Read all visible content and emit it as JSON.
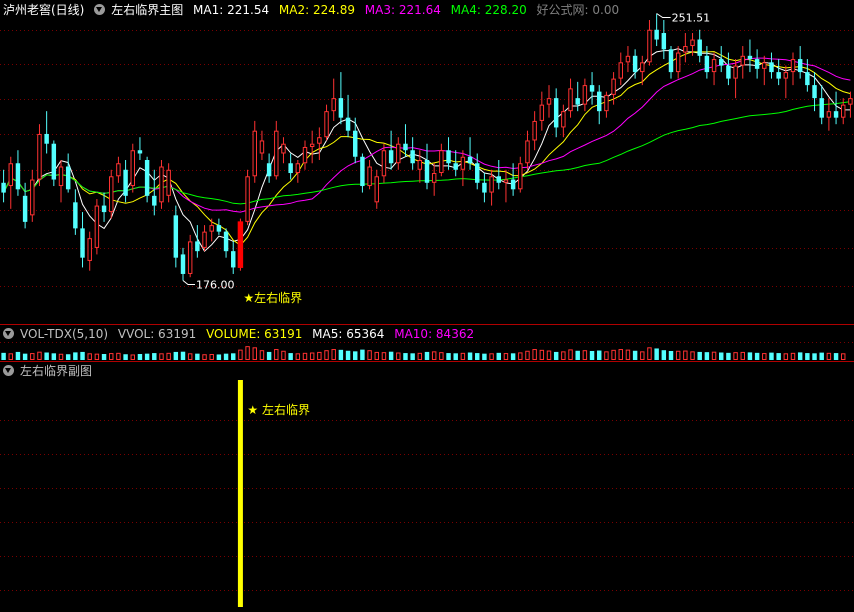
{
  "main_header": {
    "stock": "泸州老窖(日线)",
    "indicator": "左右临界主图",
    "ma1": "MA1: 221.54",
    "ma2": "MA2: 224.89",
    "ma3": "MA3: 221.64",
    "ma4": "MA4: 228.20",
    "site": "好公式网: 0.00"
  },
  "vol_header": {
    "name": "VOL-TDX(5,10)",
    "vvol": "VVOL: 63191",
    "volume": "VOLUME: 63191",
    "ma5": "MA5: 65364",
    "ma10": "MA10: 84362"
  },
  "sub_header": {
    "name": "左右临界副图"
  },
  "annotations": {
    "high_label": "251.51",
    "low_label": "176.00",
    "signal_main": "★左右临界",
    "signal_sub": "★ 左右临界"
  },
  "colors": {
    "up": "#ff3232",
    "down": "#54ffff",
    "ma1": "#ffffff",
    "ma2": "#ffff00",
    "ma3": "#ff00ff",
    "ma4": "#00ff00",
    "grid": "#7a0000",
    "signal": "#ffff00"
  },
  "chart_data": {
    "type": "candlestick",
    "price_range": [
      170,
      256
    ],
    "high": 251.51,
    "low": 176.0,
    "signal_index": 33,
    "ohlc": [
      [
        206,
        210,
        200,
        203
      ],
      [
        205,
        214,
        198,
        212
      ],
      [
        212,
        216,
        202,
        204
      ],
      [
        202,
        206,
        192,
        194
      ],
      [
        196,
        210,
        194,
        207
      ],
      [
        207,
        224,
        205,
        221
      ],
      [
        221,
        228,
        215,
        218
      ],
      [
        218,
        219,
        205,
        207
      ],
      [
        205,
        213,
        200,
        211
      ],
      [
        211,
        215,
        203,
        204
      ],
      [
        200,
        204,
        190,
        192
      ],
      [
        192,
        197,
        180,
        183
      ],
      [
        182,
        191,
        179,
        189
      ],
      [
        186,
        201,
        184,
        199
      ],
      [
        199,
        203,
        194,
        197
      ],
      [
        197,
        210,
        195,
        208
      ],
      [
        208,
        214,
        206,
        212
      ],
      [
        210,
        213,
        200,
        202
      ],
      [
        205,
        218,
        203,
        216
      ],
      [
        216,
        220,
        213,
        215
      ],
      [
        213,
        214,
        200,
        202
      ],
      [
        202,
        210,
        196,
        199
      ],
      [
        200,
        213,
        198,
        211
      ],
      [
        202,
        212,
        200,
        210
      ],
      [
        196,
        199,
        180,
        183
      ],
      [
        184,
        186,
        176,
        178
      ],
      [
        178,
        190,
        177,
        188
      ],
      [
        188,
        193,
        183,
        185
      ],
      [
        186,
        193,
        185,
        191
      ],
      [
        191,
        195,
        188,
        193
      ],
      [
        193,
        195,
        190,
        191
      ],
      [
        191,
        192,
        183,
        185
      ],
      [
        185,
        188,
        178,
        180
      ],
      [
        180,
        195,
        179,
        194
      ],
      [
        194,
        210,
        193,
        208
      ],
      [
        208,
        225,
        206,
        222
      ],
      [
        215,
        222,
        213,
        219
      ],
      [
        212,
        215,
        206,
        208
      ],
      [
        208,
        225,
        207,
        222
      ],
      [
        215,
        220,
        212,
        218
      ],
      [
        212,
        215,
        207,
        209
      ],
      [
        209,
        213,
        206,
        212
      ],
      [
        212,
        219,
        210,
        217
      ],
      [
        217,
        222,
        212,
        218
      ],
      [
        218,
        223,
        213,
        220
      ],
      [
        220,
        230,
        219,
        228
      ],
      [
        228,
        238,
        225,
        232
      ],
      [
        232,
        240,
        224,
        226
      ],
      [
        226,
        233,
        220,
        222
      ],
      [
        222,
        226,
        212,
        214
      ],
      [
        214,
        215,
        203,
        205
      ],
      [
        205,
        213,
        204,
        211
      ],
      [
        200,
        210,
        198,
        208
      ],
      [
        208,
        218,
        206,
        216
      ],
      [
        216,
        222,
        210,
        212
      ],
      [
        212,
        220,
        210,
        218
      ],
      [
        218,
        224,
        214,
        216
      ],
      [
        216,
        220,
        210,
        212
      ],
      [
        210,
        216,
        206,
        213
      ],
      [
        213,
        218,
        204,
        206
      ],
      [
        206,
        212,
        202,
        209
      ],
      [
        209,
        218,
        208,
        216
      ],
      [
        216,
        220,
        210,
        212
      ],
      [
        212,
        216,
        208,
        210
      ],
      [
        210,
        216,
        205,
        214
      ],
      [
        214,
        220,
        210,
        212
      ],
      [
        212,
        215,
        204,
        206
      ],
      [
        206,
        209,
        200,
        203
      ],
      [
        203,
        210,
        199,
        208
      ],
      [
        208,
        213,
        204,
        206
      ],
      [
        206,
        210,
        200,
        207
      ],
      [
        207,
        212,
        202,
        204
      ],
      [
        204,
        214,
        203,
        212
      ],
      [
        212,
        222,
        210,
        219
      ],
      [
        219,
        228,
        216,
        225
      ],
      [
        225,
        234,
        222,
        230
      ],
      [
        230,
        236,
        226,
        232
      ],
      [
        232,
        235,
        220,
        223
      ],
      [
        223,
        230,
        220,
        228
      ],
      [
        228,
        238,
        226,
        235
      ],
      [
        232,
        237,
        228,
        230
      ],
      [
        230,
        238,
        228,
        236
      ],
      [
        236,
        240,
        230,
        234
      ],
      [
        234,
        236,
        224,
        228
      ],
      [
        228,
        234,
        226,
        233
      ],
      [
        233,
        240,
        230,
        238
      ],
      [
        238,
        246,
        236,
        243
      ],
      [
        243,
        248,
        240,
        245
      ],
      [
        245,
        247,
        238,
        240
      ],
      [
        240,
        245,
        236,
        243
      ],
      [
        243,
        256,
        242,
        253
      ],
      [
        253,
        258,
        248,
        250
      ],
      [
        252,
        256,
        244,
        247
      ],
      [
        247,
        248,
        238,
        240
      ],
      [
        240,
        248,
        238,
        246
      ],
      [
        246,
        252,
        243,
        248
      ],
      [
        248,
        252,
        245,
        250
      ],
      [
        250,
        253,
        243,
        245
      ],
      [
        245,
        248,
        238,
        240
      ],
      [
        240,
        246,
        236,
        244
      ],
      [
        244,
        248,
        240,
        242
      ],
      [
        242,
        246,
        236,
        238
      ],
      [
        238,
        244,
        232,
        242
      ],
      [
        242,
        248,
        238,
        245
      ],
      [
        245,
        250,
        240,
        244
      ],
      [
        244,
        247,
        238,
        241
      ],
      [
        241,
        245,
        236,
        243
      ],
      [
        243,
        246,
        238,
        240
      ],
      [
        240,
        244,
        236,
        238
      ],
      [
        238,
        242,
        232,
        240
      ],
      [
        240,
        246,
        236,
        244
      ],
      [
        244,
        248,
        238,
        240
      ],
      [
        240,
        244,
        234,
        236
      ],
      [
        236,
        240,
        228,
        232
      ],
      [
        232,
        236,
        224,
        226
      ],
      [
        226,
        232,
        222,
        228
      ],
      [
        228,
        234,
        224,
        226
      ],
      [
        226,
        232,
        224,
        230
      ],
      [
        230,
        234,
        226,
        232
      ]
    ],
    "volume": [
      62,
      58,
      70,
      55,
      60,
      72,
      65,
      58,
      54,
      50,
      66,
      70,
      58,
      55,
      52,
      60,
      62,
      50,
      48,
      52,
      55,
      60,
      58,
      62,
      70,
      72,
      58,
      55,
      50,
      52,
      48,
      55,
      58,
      90,
      120,
      110,
      85,
      70,
      95,
      80,
      60,
      58,
      62,
      65,
      70,
      85,
      95,
      88,
      80,
      75,
      90,
      85,
      70,
      68,
      72,
      65,
      60,
      58,
      62,
      70,
      75,
      68,
      60,
      58,
      62,
      65,
      60,
      55,
      58,
      62,
      60,
      58,
      66,
      80,
      95,
      88,
      82,
      70,
      75,
      92,
      80,
      85,
      78,
      82,
      75,
      88,
      95,
      90,
      80,
      75,
      110,
      100,
      85,
      78,
      80,
      82,
      75,
      70,
      68,
      72,
      65,
      62,
      68,
      70,
      66,
      62,
      60,
      64,
      60,
      58,
      62,
      66,
      60,
      58,
      64,
      62,
      60,
      58
    ],
    "vol_max": 130
  }
}
